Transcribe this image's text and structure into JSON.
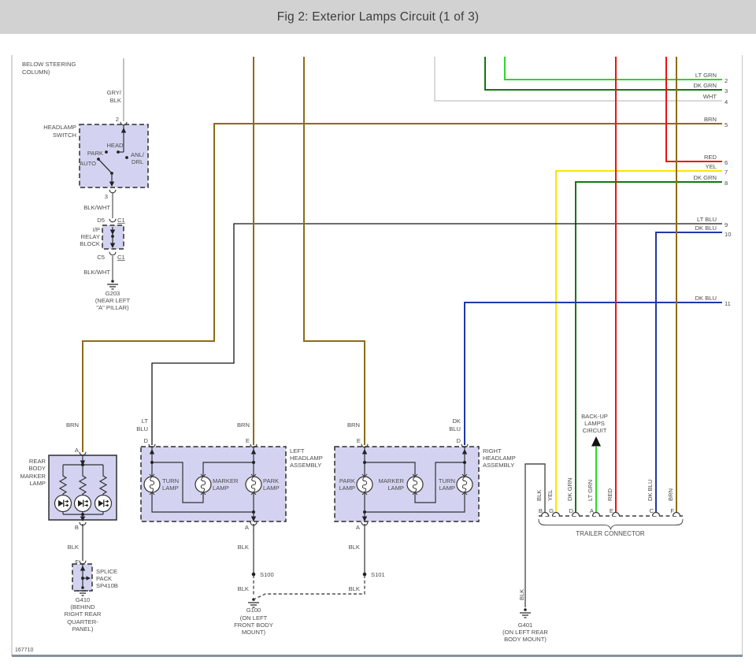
{
  "header": {
    "title": "Fig 2: Exterior Lamps Circuit (1 of 3)"
  },
  "figure_id": "167710",
  "colors": {
    "brn": "#8d6c17",
    "lt_grn": "#2ed52e",
    "dk_grn": "#127812",
    "wht": "#d9d9d9",
    "red": "#ee1111",
    "yel": "#f7e800",
    "dk_blu": "#2238a6",
    "lt_blu": "#161616",
    "blk": "#4f4f4f",
    "gry": "#a8a8a8",
    "blk_wht": "#6f6f6f",
    "box_fill": "#d3d3f1"
  },
  "note_below_steering": {
    "line1": "BELOW STEERING",
    "line2": "COLUMN)"
  },
  "switch": {
    "label1": "HEADLAMP",
    "label2": "SWITCH",
    "wire_in1": "GRY/",
    "wire_in2": "BLK",
    "pin_in": "2",
    "pin_out": "3",
    "pos_head": "HEAD",
    "pos_park": "PARK",
    "pos_auto": "AUTO",
    "pos_anl": "ANL/",
    "pos_drl": "DRL",
    "wire_out": "BLK/WHT"
  },
  "relay": {
    "pin_in": "D5",
    "conn_in": "C1",
    "label1": "I/P",
    "label2": "RELAY",
    "label3": "BLOCK",
    "pin_out": "C5",
    "conn_out": "C1",
    "wire_out": "BLK/WHT"
  },
  "g203": {
    "id": "G203",
    "loc1": "(NEAR LEFT",
    "loc2": "\"A\" PILLAR)"
  },
  "right_pins": [
    {
      "label": "LT GRN",
      "num": "2"
    },
    {
      "label": "DK GRN",
      "num": "3"
    },
    {
      "label": "WHT",
      "num": "4"
    },
    {
      "label": "BRN",
      "num": "5"
    },
    {
      "label": "RED",
      "num": "6"
    },
    {
      "label": "YEL",
      "num": "7"
    },
    {
      "label": "DK GRN",
      "num": "8"
    },
    {
      "label": "LT BLU",
      "num": "9"
    },
    {
      "label": "DK BLU",
      "num": "10"
    },
    {
      "label": "DK BLU",
      "num": "11"
    }
  ],
  "feed_labels": {
    "rear_brn": "BRN",
    "left_ltblu1": "LT",
    "left_ltblu2": "BLU",
    "left_brn": "BRN",
    "right_brn": "BRN",
    "right_dkblu1": "DK",
    "right_dkblu2": "BLU"
  },
  "rear_marker": {
    "label1": "REAR",
    "label2": "BODY",
    "label3": "MARKER",
    "label4": "LAMP",
    "pin_a": "A",
    "pin_b": "B",
    "pin_f": "F",
    "wire_blk": "BLK"
  },
  "splice_pack": {
    "label1": "SPLICE",
    "label2": "PACK",
    "label3": "SP410B"
  },
  "g410": {
    "id": "G410",
    "loc1": "(BEHIND",
    "loc2": "RIGHT REAR",
    "loc3": "QUARTER-",
    "loc4": "PANEL)"
  },
  "left_assembly": {
    "pin_d": "D",
    "pin_e": "E",
    "pin_a": "A",
    "label1": "LEFT",
    "label2": "HEADLAMP",
    "label3": "ASSEMBLY",
    "turn1": "TURN",
    "turn2": "LAMP",
    "marker1": "MARKER",
    "marker2": "LAMP",
    "park1": "PARK",
    "park2": "LAMP",
    "wire_blk": "BLK",
    "splice": "S100",
    "wire_blk2": "BLK"
  },
  "right_assembly": {
    "pin_d": "D",
    "pin_e": "E",
    "pin_a": "A",
    "label1": "RIGHT",
    "label2": "HEADLAMP",
    "label3": "ASSEMBLY",
    "turn1": "TURN",
    "turn2": "LAMP",
    "marker1": "MARKER",
    "marker2": "LAMP",
    "park1": "PARK",
    "park2": "LAMP",
    "wire_blk": "BLK",
    "splice": "S101",
    "wire_blk2": "BLK"
  },
  "g100": {
    "id": "G100",
    "loc1": "(ON LEFT",
    "loc2": "FRONT BODY",
    "loc3": "MOUNT)"
  },
  "backup": {
    "line1": "BACK-UP",
    "line2": "LAMPS",
    "line3": "CIRCUIT"
  },
  "trailer": {
    "label": "TRAILER CONNECTOR",
    "pins": [
      {
        "letter": "B",
        "wire": "BLK"
      },
      {
        "letter": "G",
        "wire": "YEL"
      },
      {
        "letter": "D",
        "wire": "DK GRN"
      },
      {
        "letter": "A",
        "wire": "LT GRN"
      },
      {
        "letter": "E",
        "wire": "RED"
      },
      {
        "letter": "C",
        "wire": "DK BLU"
      },
      {
        "letter": "F",
        "wire": "BRN"
      }
    ]
  },
  "g401": {
    "id": "G401",
    "wire": "BLK",
    "loc1": "(ON LEFT REAR",
    "loc2": "BODY MOUNT)"
  }
}
